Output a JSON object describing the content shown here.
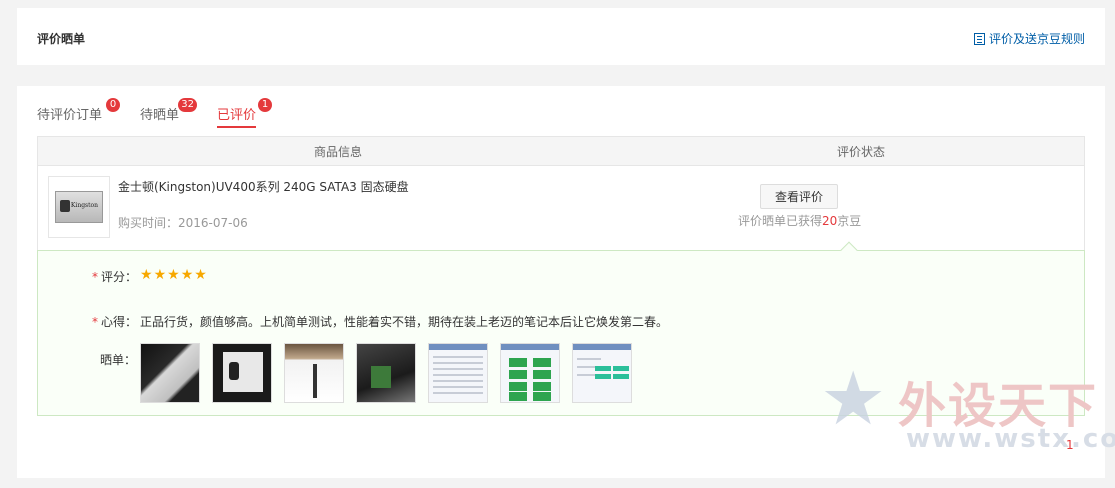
{
  "header": {
    "title": "评价晒单",
    "rules_link": "评价及送京豆规则"
  },
  "tabs": [
    {
      "label": "待评价订单",
      "count": "0"
    },
    {
      "label": "待晒单",
      "count": "32"
    },
    {
      "label": "已评价",
      "count": "1"
    }
  ],
  "table": {
    "col_product": "商品信息",
    "col_status": "评价状态"
  },
  "order": {
    "product_name": "金士顿(Kingston)UV400系列 240G SATA3 固态硬盘",
    "thumb_brand": "Kingston",
    "purchase_label": "购买时间：",
    "purchase_date": "2016-07-06",
    "view_button": "查看评价",
    "earned_prefix": "评价晒单已获得",
    "earned_amount": "20",
    "earned_suffix": "京豆"
  },
  "review": {
    "rating_label": "评分：",
    "rating_stars": 5,
    "experience_label": "心得：",
    "experience_text": "正品行货，颜值够高。上机简单测试，性能着实不错，期待在装上老迈的笔记本后让它焕发第二春。",
    "photos_label": "晒单：",
    "photos": [
      "photo-1",
      "photo-2",
      "photo-3",
      "photo-4",
      "photo-5",
      "photo-6",
      "photo-7"
    ]
  },
  "watermark": {
    "text": "外设天下",
    "url": "www.wstx.com"
  },
  "pagination": {
    "current": "1"
  },
  "colors": {
    "accent_red": "#e4393c",
    "link_blue": "#005ea7",
    "star": "#f7a800",
    "review_bg": "#fafff8"
  }
}
